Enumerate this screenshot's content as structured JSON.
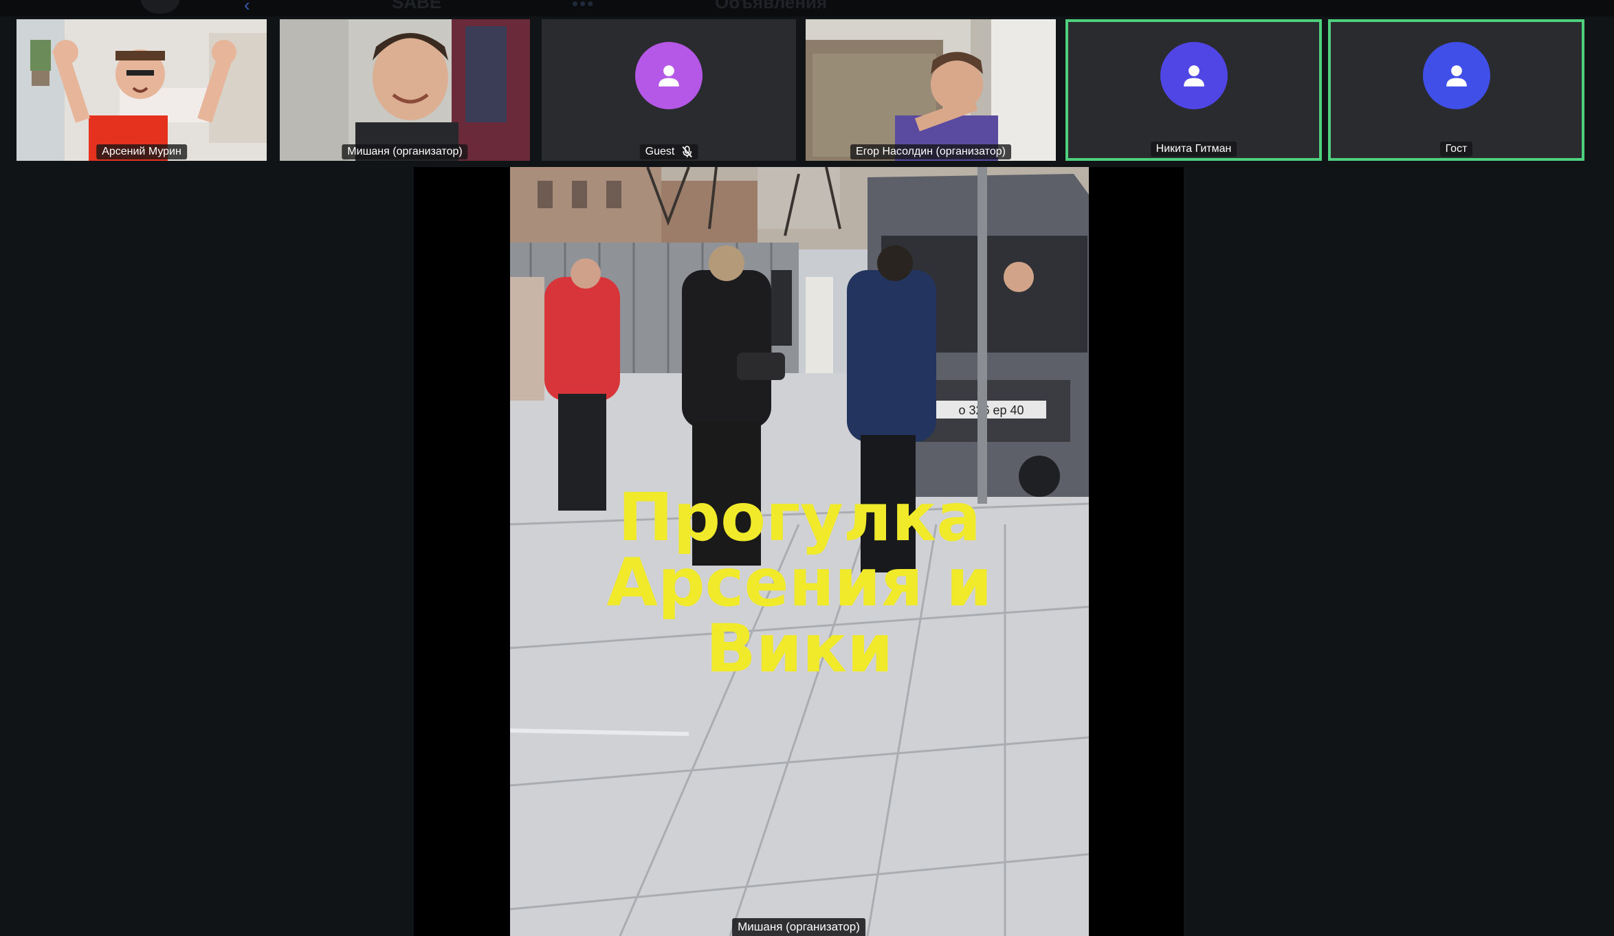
{
  "topbar": {
    "ghost_a": "SABE",
    "ghost_b": "Объявления"
  },
  "participants": [
    {
      "name": "Арсений Мурин",
      "type": "video",
      "speaking": false,
      "muted": false
    },
    {
      "name": "Мишаня (организатор)",
      "type": "video",
      "speaking": false,
      "muted": false
    },
    {
      "name": "Guest",
      "type": "avatar",
      "avatar_color": "#b558e8",
      "speaking": false,
      "muted": true
    },
    {
      "name": "Егор Насолдин (организатор)",
      "type": "video",
      "speaking": false,
      "muted": false
    },
    {
      "name": "Никита Гитман",
      "type": "avatar",
      "avatar_color": "#4f46e5",
      "speaking": true,
      "muted": false
    },
    {
      "name": "Гост",
      "type": "avatar",
      "avatar_color": "#3f4fe8",
      "speaking": true,
      "muted": false
    }
  ],
  "main_video": {
    "title_line1": "Прогулка",
    "title_line2": "Арсения и Вики",
    "speaker_label": "Мишаня (организатор)",
    "plate_text": "о 326 ер 40"
  },
  "colors": {
    "speaking_border": "#4fd07e",
    "title_text": "#f0ea2a",
    "background": "#111417"
  },
  "icons": {
    "person": "person-icon",
    "mic_off": "mic-off-icon"
  }
}
